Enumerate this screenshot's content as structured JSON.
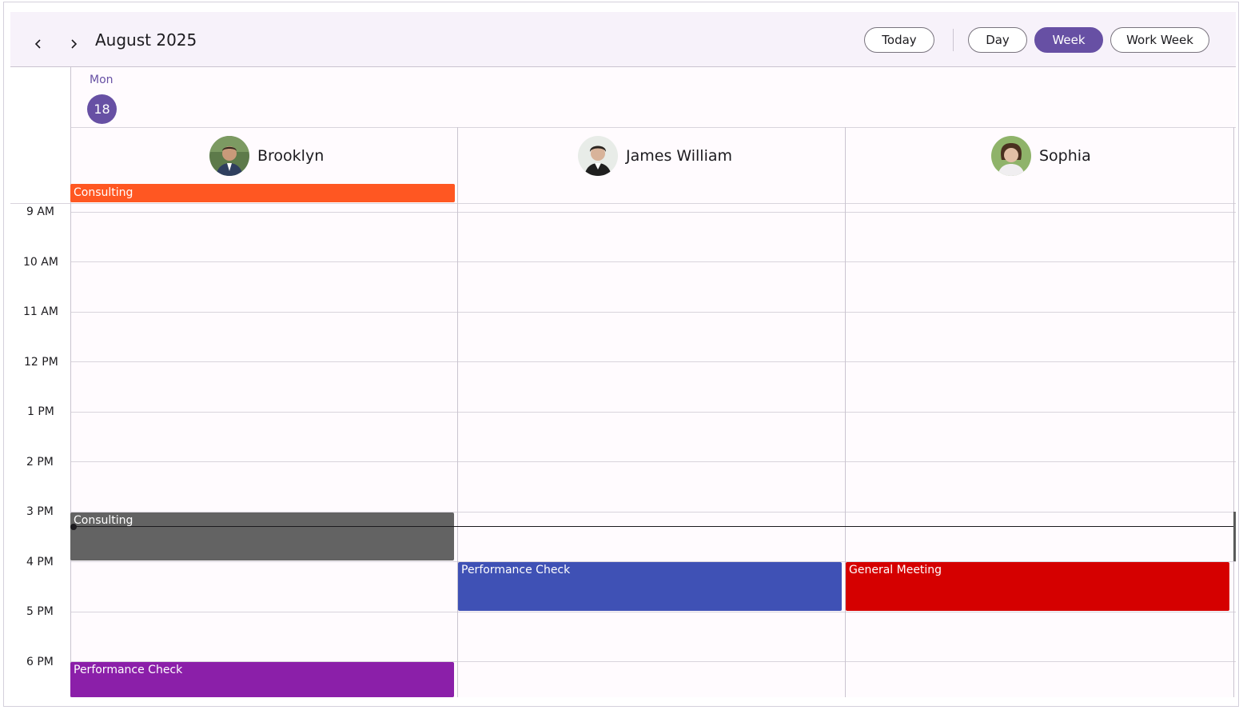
{
  "header": {
    "title": "August 2025",
    "prev_icon": "chevron-left-icon",
    "next_icon": "chevron-right-icon",
    "buttons": {
      "today": "Today",
      "day": "Day",
      "week": "Week",
      "work_week": "Work Week"
    },
    "active_view": "Week"
  },
  "day": {
    "name": "Mon",
    "number": "18"
  },
  "resources": [
    {
      "name": "Brooklyn"
    },
    {
      "name": "James William"
    },
    {
      "name": "Sophia"
    }
  ],
  "times": [
    "9 AM",
    "10 AM",
    "11 AM",
    "12 PM",
    "1 PM",
    "2 PM",
    "3 PM",
    "4 PM",
    "5 PM",
    "6 PM"
  ],
  "appointments": {
    "allday": {
      "subject": "Consulting",
      "resource": "Brooklyn",
      "color": "#ff5722"
    },
    "a1": {
      "subject": "Consulting",
      "resource": "Brooklyn",
      "start": "3 PM",
      "end": "4 PM",
      "color": "#636363"
    },
    "a2": {
      "subject": "Performance Check",
      "resource": "James William",
      "start": "4 PM",
      "end": "5 PM",
      "color": "#3f51b5"
    },
    "a3": {
      "subject": "General Meeting",
      "resource": "Sophia",
      "start": "4 PM",
      "end": "5 PM",
      "color": "#d50000"
    },
    "a4": {
      "subject": "Performance Check",
      "resource": "Brooklyn",
      "start": "6 PM",
      "color": "#8b1fa9"
    }
  },
  "colors": {
    "accent": "#6750a4",
    "header_bg": "#f7f2fa",
    "grid_bg": "#fffbfe"
  }
}
